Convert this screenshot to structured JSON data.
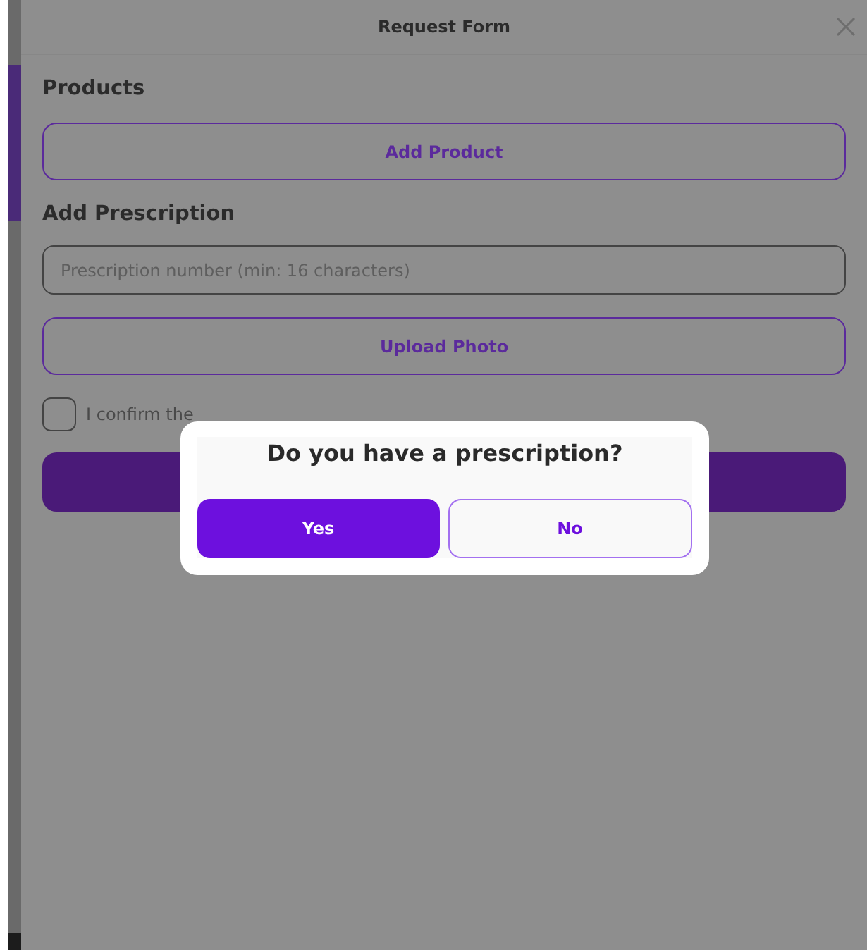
{
  "window": {
    "title": "Request Form"
  },
  "products": {
    "heading": "Products",
    "button": "Add Product"
  },
  "prescription": {
    "heading": "Add Prescription",
    "placeholder": "Prescription number (min: 16 characters)",
    "upload_button": "Upload Photo"
  },
  "confirm": {
    "label": "I confirm the",
    "checked": false
  },
  "dialog": {
    "question": "Do you have a prescription?",
    "buttons": [
      {
        "label": "Yes",
        "kind": "primary"
      },
      {
        "label": "No",
        "kind": "secondary"
      }
    ]
  }
}
